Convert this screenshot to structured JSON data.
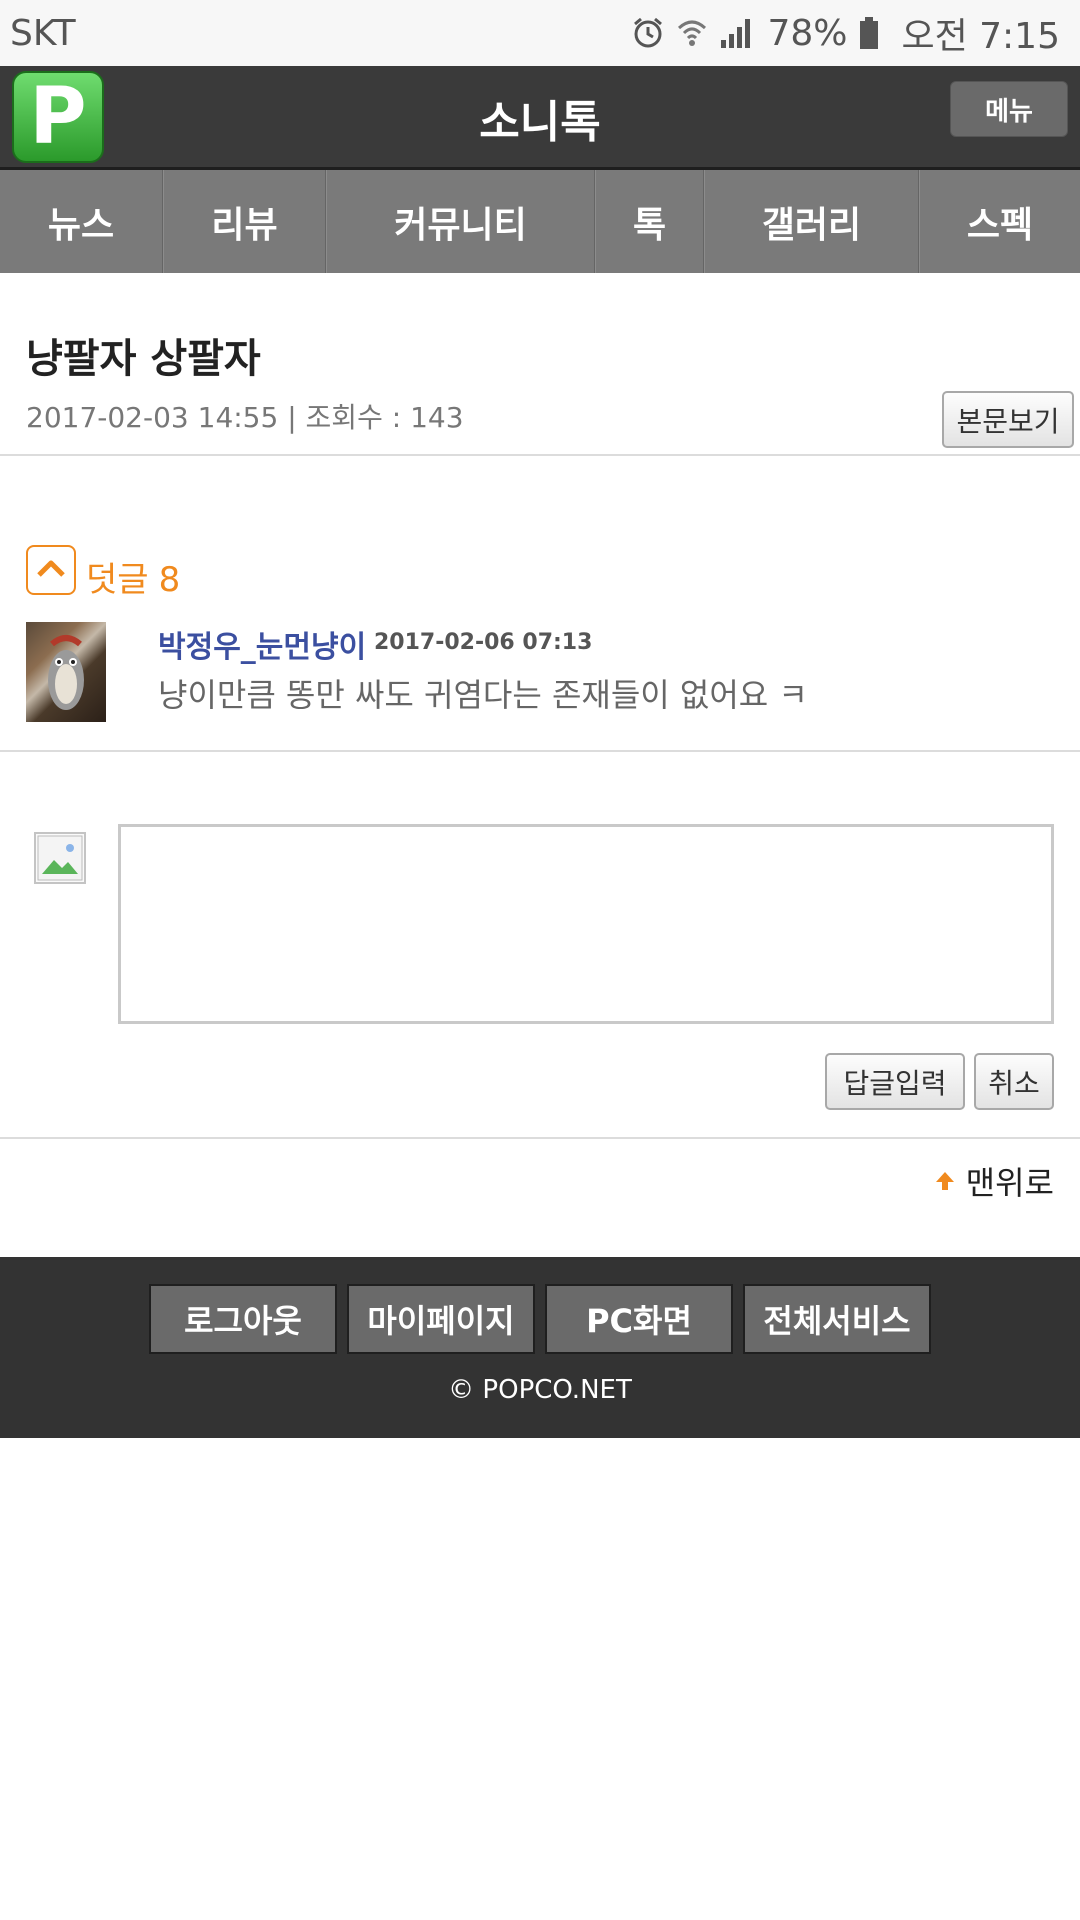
{
  "status_bar": {
    "carrier": "SKT",
    "battery_percent": "78%",
    "time": "오전 7:15",
    "icons": [
      "alarm-icon",
      "wifi-icon",
      "signal-icon",
      "battery-icon"
    ]
  },
  "header": {
    "logo_letter": "P",
    "title": "소니톡",
    "menu_label": "메뉴"
  },
  "nav": {
    "items": [
      "뉴스",
      "리뷰",
      "커뮤니티",
      "톡",
      "갤러리",
      "스펙"
    ]
  },
  "post": {
    "title": "냥팔자 상팔자",
    "meta": "2017-02-03 14:55 | 조회수 : 143",
    "view_body_label": "본문보기"
  },
  "comments": {
    "label": "덧글",
    "count": "8",
    "items": [
      {
        "author": "박정우_눈먼냥이",
        "date": "2017-02-06 07:13",
        "text": "냥이만큼 똥만 싸도 귀염다는 존재들이 없어요 ㅋ"
      }
    ]
  },
  "reply_form": {
    "textarea_value": "",
    "submit_label": "답글입력",
    "cancel_label": "취소"
  },
  "to_top_label": "맨위로",
  "footer": {
    "buttons": [
      "로그아웃",
      "마이페이지",
      "PC화면",
      "전체서비스"
    ],
    "copyright": "© POPCO.NET"
  },
  "colors": {
    "accent_orange": "#f08a1e",
    "author_blue": "#3b4fa0",
    "header_bg": "#3a3a3a",
    "nav_bg": "#7a7a7a",
    "footer_bg": "#333333"
  }
}
